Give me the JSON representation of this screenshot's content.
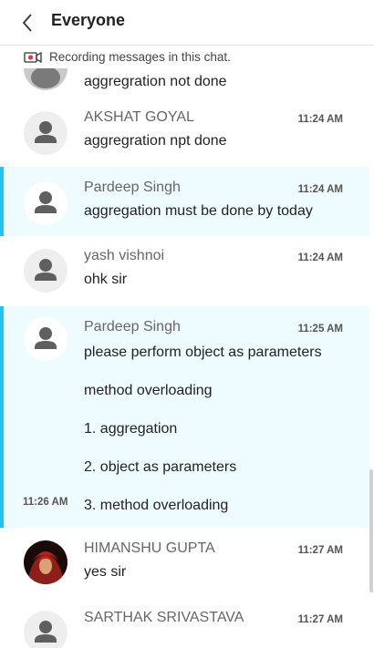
{
  "header": {
    "title": "Everyone",
    "back_icon": "chevron-left-icon"
  },
  "recording": {
    "text": "Recording messages in this chat.",
    "icon": "video-record-icon"
  },
  "messages": [
    {
      "text": "aggregration not done"
    },
    {
      "sender": "AKSHAT GOYAL",
      "time": "11:24 AM",
      "text": "aggregration npt done"
    },
    {
      "sender": "Pardeep Singh",
      "time": "11:24 AM",
      "text": "aggregation must be done by today"
    },
    {
      "sender": "yash vishnoi",
      "time": "11:24 AM",
      "text": "ohk sir"
    },
    {
      "sender": "Pardeep Singh",
      "time": "11:25 AM",
      "text": "please perform object as parameters"
    },
    {
      "text": "method overloading"
    },
    {
      "text": "1. aggregation"
    },
    {
      "text": "2. object as parameters"
    },
    {
      "time": "11:26 AM",
      "text": "3. method overloading"
    },
    {
      "sender": "HIMANSHU GUPTA",
      "time": "11:27 AM",
      "text": "yes sir"
    },
    {
      "sender": "SARTHAK SRIVASTAVA",
      "time": "11:27 AM"
    }
  ],
  "colors": {
    "highlight_bg": "#eefbff",
    "highlight_bar": "#23c3f2",
    "record_red": "#e53935"
  }
}
